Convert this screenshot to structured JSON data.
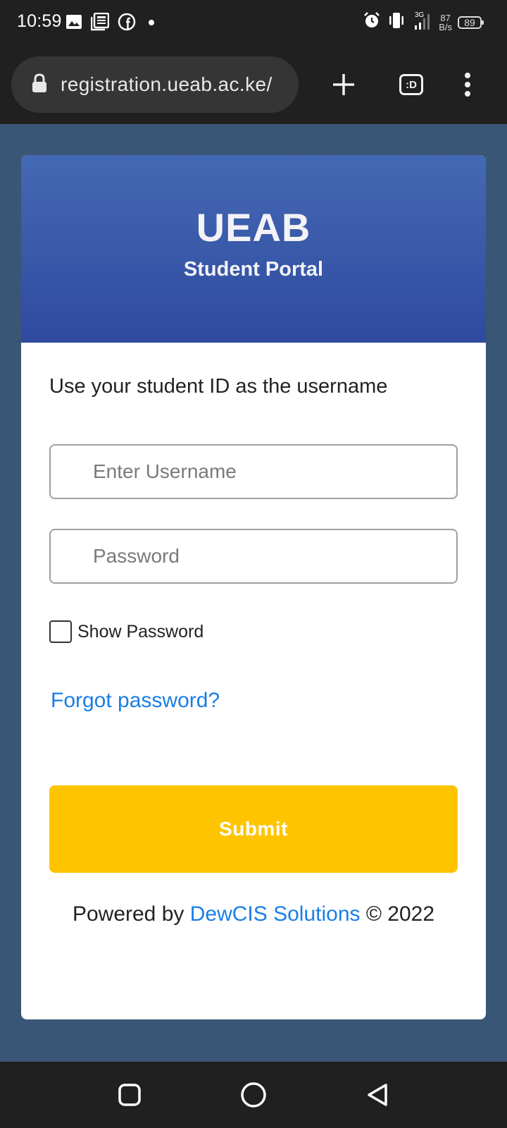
{
  "status_bar": {
    "time": "10:59",
    "net_speed_value": "87",
    "net_speed_unit": "B/s",
    "signal_type": "3G",
    "battery": "89"
  },
  "browser": {
    "url": "registration.ueab.ac.ke/",
    "tab_label": ":D"
  },
  "portal": {
    "title": "UEAB",
    "subtitle": "Student Portal",
    "instructions": "Use your student ID as the username",
    "username_placeholder": "Enter Username",
    "password_placeholder": "Password",
    "show_password_label": "Show Password",
    "forgot_password": "Forgot password?",
    "submit_label": "Submit",
    "footer_prefix": "Powered by",
    "footer_link": "DewCIS Solutions",
    "footer_suffix": "© 2022"
  },
  "colors": {
    "header_gradient_top": "#4469b3",
    "header_gradient_bottom": "#2f4aa0",
    "submit": "#ffc400",
    "link": "#1a7ee6",
    "page_background": "#3a5676"
  },
  "icons": {
    "status_left": [
      "image-icon",
      "news-icon",
      "facebook-icon",
      "dot-icon"
    ],
    "status_right": [
      "alarm-icon",
      "vibrate-icon",
      "signal-icon",
      "battery-icon"
    ],
    "browser": [
      "lock-icon",
      "new-tab-icon",
      "tab-switcher-icon",
      "more-icon"
    ],
    "nav": [
      "recents-icon",
      "home-icon",
      "back-icon"
    ]
  }
}
